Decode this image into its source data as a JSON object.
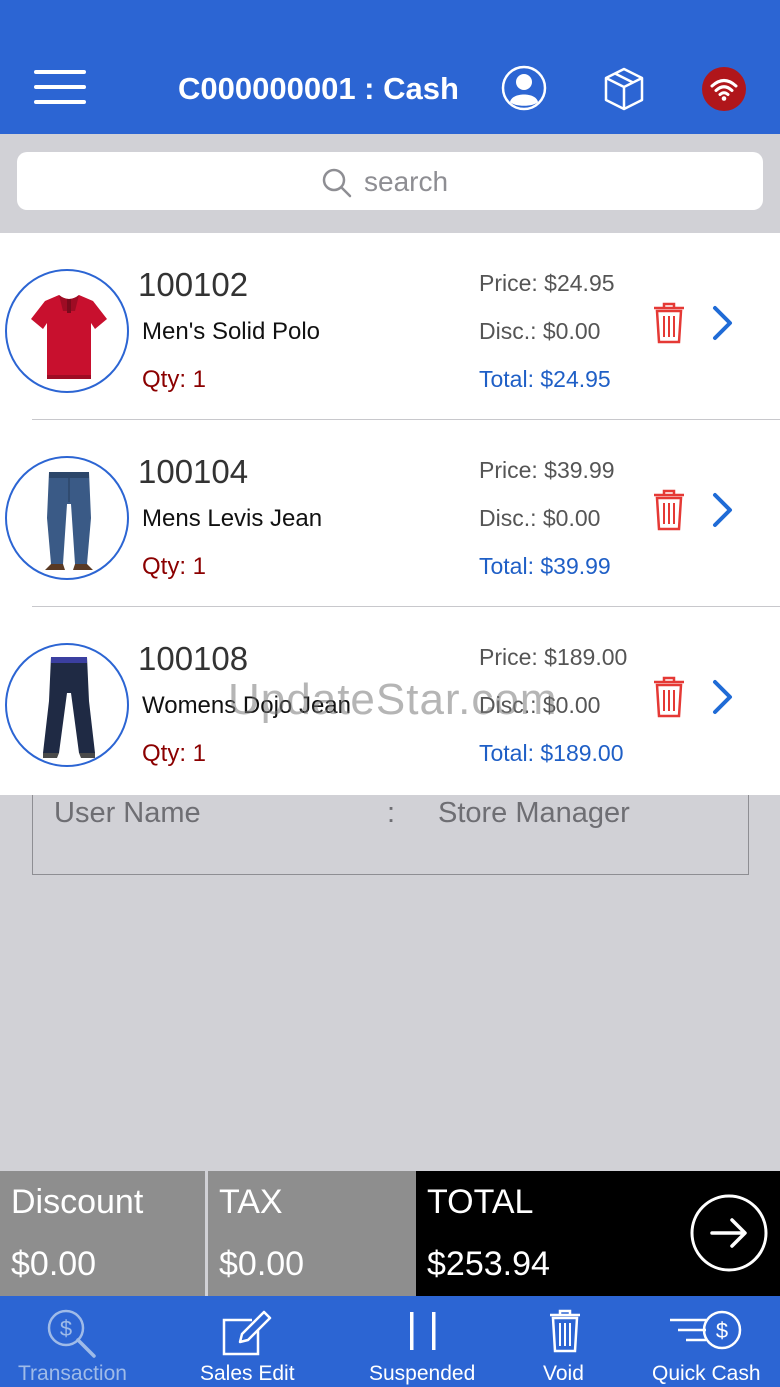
{
  "header": {
    "title": "C000000001 : Cash"
  },
  "search": {
    "placeholder": "search"
  },
  "items": [
    {
      "code": "100102",
      "name": "Men's Solid Polo",
      "qty": "Qty: 1",
      "price": "Price: $24.95",
      "disc": "Disc.: $0.00",
      "total": "Total: $24.95",
      "image": "red-polo-shirt"
    },
    {
      "code": "100104",
      "name": "Mens Levis Jean",
      "qty": "Qty: 1",
      "price": "Price: $39.99",
      "disc": "Disc.: $0.00",
      "total": "Total: $39.99",
      "image": "blue-jeans"
    },
    {
      "code": "100108",
      "name": "Womens Dojo Jean",
      "qty": "Qty: 1",
      "price": "Price: $189.00",
      "disc": "Disc.: $0.00",
      "total": "Total: $189.00",
      "image": "dark-flare-jeans"
    }
  ],
  "watermark": "UpdateStar.com",
  "user_info": {
    "label": "User Name",
    "separator": ":",
    "value": "Store Manager"
  },
  "totals": {
    "discount_label": "Discount",
    "discount_value": "$0.00",
    "tax_label": "TAX",
    "tax_value": "$0.00",
    "total_label": "TOTAL",
    "total_value": "$253.94"
  },
  "tabs": [
    {
      "label": "Transaction",
      "icon": "dollar-search-icon",
      "active": false
    },
    {
      "label": "Sales Edit",
      "icon": "edit-icon",
      "active": true
    },
    {
      "label": "Suspended",
      "icon": "pause-icon",
      "active": true
    },
    {
      "label": "Void",
      "icon": "trash-icon",
      "active": true
    },
    {
      "label": "Quick Cash",
      "icon": "quick-cash-icon",
      "active": true
    }
  ],
  "colors": {
    "primary": "#2c65d3",
    "delete": "#e53935",
    "qty": "#8b0000",
    "total_text": "#1f5fc6"
  }
}
